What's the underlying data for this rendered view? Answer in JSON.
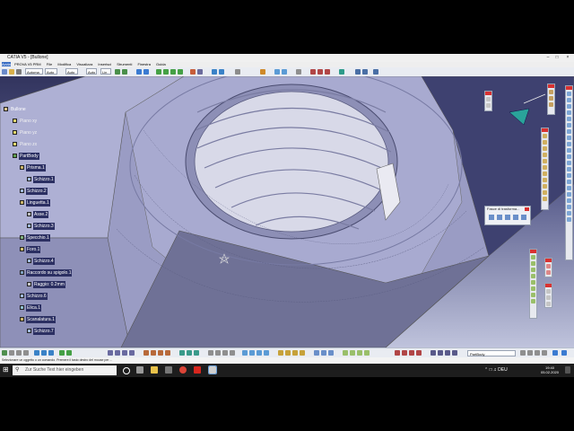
{
  "window": {
    "title": "CATIA V5 - [Bullone]"
  },
  "menubar": {
    "items": [
      "Avvia",
      "PROVA V5 PRM",
      "File",
      "Modifica",
      "Visualizza",
      "Inserisci",
      "Strumenti",
      "Finestra",
      "Guida"
    ]
  },
  "toolbar": {
    "combos": [
      "Automa",
      "Auto",
      "Auto",
      "Auto",
      "Lin"
    ]
  },
  "tree": {
    "nodes": [
      {
        "label": "Bullone"
      },
      {
        "label": "Piano xy"
      },
      {
        "label": "Piano yz"
      },
      {
        "label": "Piano zx"
      },
      {
        "label": "PartBody"
      },
      {
        "label": "Prisma.1"
      },
      {
        "label": "Schizzo.1"
      },
      {
        "label": "Schizzo.2"
      },
      {
        "label": "Linguetta.1"
      },
      {
        "label": "Asse.2"
      },
      {
        "label": "Schizzo.3"
      },
      {
        "label": "Specchio.1"
      },
      {
        "label": "Foro.1"
      },
      {
        "label": "Schizzo.4"
      },
      {
        "label": "Raccordo su spigolo.1"
      },
      {
        "label": "Raggio: 0.2mm"
      },
      {
        "label": "Schizzo.6"
      },
      {
        "label": "Elica.1"
      },
      {
        "label": "Scanalatura.1"
      },
      {
        "label": "Schizzo.7"
      }
    ]
  },
  "float_panel": {
    "title": "Fasce di trasforma..."
  },
  "bottom_toolbar": {
    "body_combo": "PartBody"
  },
  "status_bar": {
    "text": "Selezionare un oggetto o un comando. Premere il tasto destro del mouse per ..."
  },
  "taskbar": {
    "search_placeholder": "Zur Suche Text hier eingeben",
    "time": "19:40",
    "date": "05.02.2020"
  },
  "colors": {
    "viewport_top": "#32345e",
    "viewport_bottom": "#bfc3dc",
    "tree_highlight": "#2b2f62",
    "close_red": "#d93131"
  }
}
